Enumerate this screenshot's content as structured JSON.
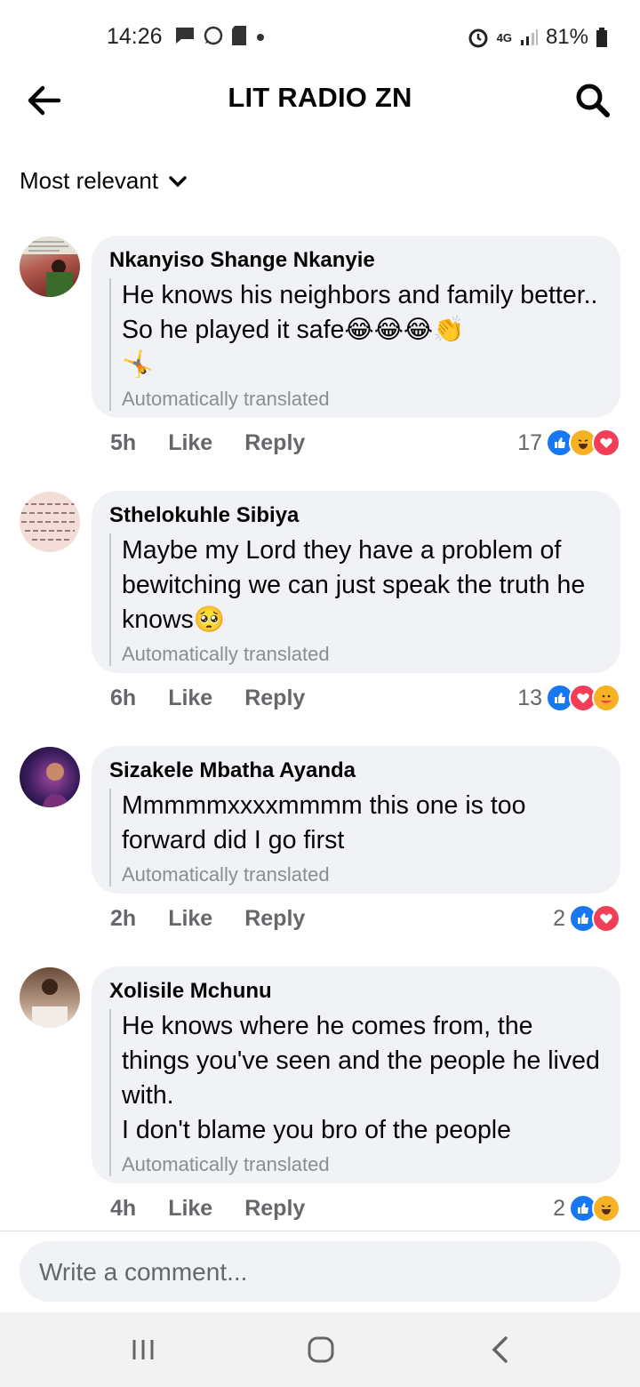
{
  "status_bar": {
    "time": "14:26",
    "battery": "81%",
    "network": "4G"
  },
  "header": {
    "title": "LIT RADIO ZN"
  },
  "sort": {
    "label": "Most relevant"
  },
  "comments": [
    {
      "author": "Nkanyiso Shange Nkanyie",
      "text": "He knows his neighbors and family better.. So he played it safe😂😂😂👏\n🤸",
      "translated": "Automatically translated",
      "time": "5h",
      "like": "Like",
      "reply": "Reply",
      "reaction_count": "17",
      "reactions": [
        "like",
        "haha",
        "love"
      ]
    },
    {
      "author": "Sthelokuhle Sibiya",
      "text": "Maybe my Lord they have a problem of bewitching we can just speak the truth he knows🥺",
      "translated": "Automatically translated",
      "time": "6h",
      "like": "Like",
      "reply": "Reply",
      "reaction_count": "13",
      "reactions": [
        "like",
        "love",
        "care"
      ]
    },
    {
      "author": "Sizakele Mbatha Ayanda",
      "text": "Mmmmmxxxxmmmm this one is too forward did I go first",
      "translated": "Automatically translated",
      "time": "2h",
      "like": "Like",
      "reply": "Reply",
      "reaction_count": "2",
      "reactions": [
        "like",
        "love"
      ]
    },
    {
      "author": "Xolisile Mchunu",
      "text": "He knows where he comes from, the things you've seen and the people he lived with.\nI don't blame you bro of the people",
      "translated": "Automatically translated",
      "time": "4h",
      "like": "Like",
      "reply": "Reply",
      "reaction_count": "2",
      "reactions": [
        "like",
        "haha"
      ]
    }
  ],
  "composer": {
    "placeholder": "Write a comment..."
  },
  "colors": {
    "bubble": "#f0f2f5",
    "like": "#1877f2",
    "love": "#f33e58",
    "haha": "#f7b125",
    "muted": "#65676b"
  }
}
